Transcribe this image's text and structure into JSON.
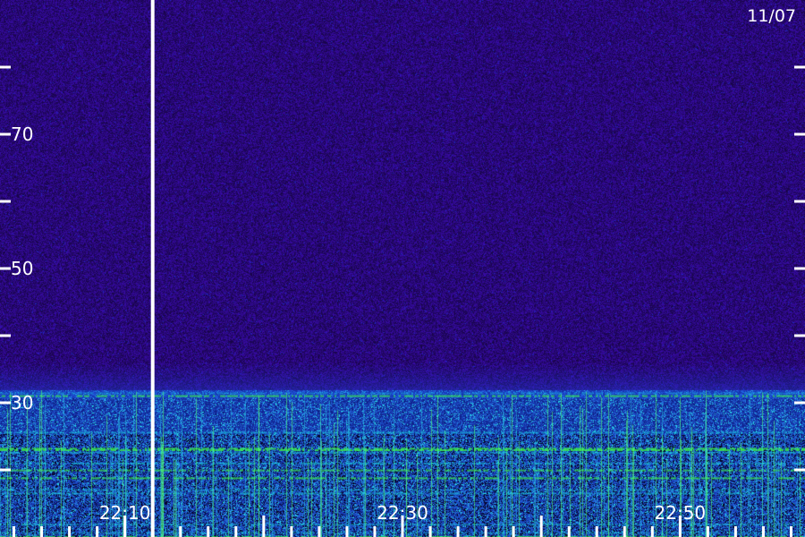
{
  "date_label": "11/07",
  "chart_data": {
    "type": "heatmap",
    "title": "",
    "xlabel": "",
    "ylabel": "",
    "y_tick_labels": [
      "70",
      "50",
      "30"
    ],
    "y_tick_values": [
      70,
      50,
      30
    ],
    "x_tick_labels": [
      "22:10",
      "22:30",
      "22:50"
    ],
    "x_start": "22:01",
    "x_end": "22:59",
    "y_range": [
      10,
      90
    ],
    "marker_line_time": "22:12",
    "colors": {
      "background": "#2a0a78",
      "noise_dark": "#1a0650",
      "low_band": "#1438c8",
      "cyan": "#18d0e0",
      "green": "#40ff40",
      "marker": "#ffffff"
    }
  }
}
